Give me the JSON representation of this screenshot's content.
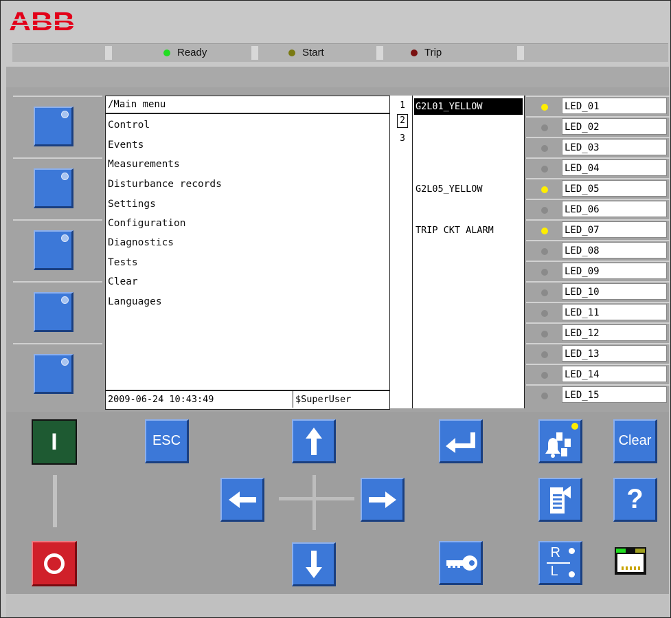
{
  "brand": {
    "logo_text": "ABB",
    "color": "#e2001a"
  },
  "status": {
    "ready": {
      "label": "Ready",
      "color": "#22dd22"
    },
    "start": {
      "label": "Start",
      "color": "#7a7a12"
    },
    "trip": {
      "label": "Trip",
      "color": "#7a1010"
    }
  },
  "menu": {
    "title": "/Main menu",
    "items": [
      "Control",
      "Events",
      "Measurements",
      "Disturbance records",
      "Settings",
      "Configuration",
      "Diagnostics",
      "Tests",
      "Clear",
      "Languages"
    ],
    "datetime": "2009-06-24 10:43:49",
    "user": "$SuperUser"
  },
  "pages": {
    "items": [
      "1",
      "2",
      "3"
    ],
    "selected": "2"
  },
  "alarms": {
    "rows": [
      {
        "text": "G2L01_YELLOW",
        "highlighted": true
      },
      {
        "text": ""
      },
      {
        "text": ""
      },
      {
        "text": ""
      },
      {
        "text": "G2L05_YELLOW"
      },
      {
        "text": ""
      },
      {
        "text": "TRIP CKT ALARM"
      }
    ]
  },
  "leds": [
    {
      "label": "LED_01",
      "state": "yellow"
    },
    {
      "label": "LED_02",
      "state": "off"
    },
    {
      "label": "LED_03",
      "state": "off"
    },
    {
      "label": "LED_04",
      "state": "off"
    },
    {
      "label": "LED_05",
      "state": "yellow"
    },
    {
      "label": "LED_06",
      "state": "off"
    },
    {
      "label": "LED_07",
      "state": "yellow"
    },
    {
      "label": "LED_08",
      "state": "off"
    },
    {
      "label": "LED_09",
      "state": "off"
    },
    {
      "label": "LED_10",
      "state": "off"
    },
    {
      "label": "LED_11",
      "state": "off"
    },
    {
      "label": "LED_12",
      "state": "off"
    },
    {
      "label": "LED_13",
      "state": "off"
    },
    {
      "label": "LED_14",
      "state": "off"
    },
    {
      "label": "LED_15",
      "state": "off"
    }
  ],
  "keys": {
    "close": {
      "label": "I",
      "color": "#1e5a32"
    },
    "open": {
      "color": "#d0202a"
    },
    "esc": "ESC",
    "clear": "Clear",
    "help": "?",
    "rl_remote": "R",
    "rl_local": "L"
  },
  "colors": {
    "key_blue": "#3c78d8",
    "led_yellow": "#ffee00",
    "led_off": "#8a8a8a"
  }
}
